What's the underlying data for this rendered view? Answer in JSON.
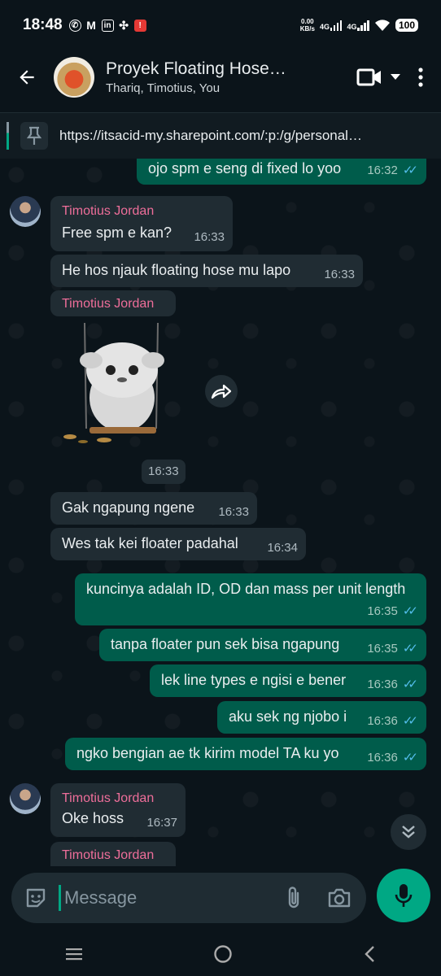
{
  "status_bar": {
    "time": "18:48",
    "net_speed_value": "0.00",
    "net_speed_unit": "KB/s",
    "sim1": "4G",
    "sim2": "4G",
    "battery": "100"
  },
  "header": {
    "title": "Proyek Floating Hose…",
    "subtitle": "Thariq, Timotius, You"
  },
  "pinned": {
    "url": "https://itsacid-my.sharepoint.com/:p:/g/personal…"
  },
  "messages": [
    {
      "dir": "out",
      "text": "ojo spm e seng di fixed lo yoo",
      "time": "16:32",
      "ticks": "✓✓"
    },
    {
      "dir": "in",
      "sender": "Timotius Jordan",
      "text": "Free spm e kan?",
      "time": "16:33"
    },
    {
      "dir": "in",
      "text": "He hos njauk floating hose mu lapo",
      "time": "16:33"
    },
    {
      "dir": "in",
      "sender": "Timotius Jordan",
      "sticker": true,
      "time": "16:33"
    },
    {
      "dir": "in",
      "text": "Gak ngapung ngene",
      "time": "16:33"
    },
    {
      "dir": "in",
      "text": "Wes tak kei floater padahal",
      "time": "16:34"
    },
    {
      "dir": "out",
      "text": "kuncinya adalah ID, OD dan mass per unit length",
      "time": "16:35",
      "ticks": "✓✓"
    },
    {
      "dir": "out",
      "text": "tanpa floater pun sek bisa ngapung",
      "time": "16:35",
      "ticks": "✓✓"
    },
    {
      "dir": "out",
      "text": "lek line types e ngisi e bener",
      "time": "16:36",
      "ticks": "✓✓"
    },
    {
      "dir": "out",
      "text": "aku sek ng njobo i",
      "time": "16:36",
      "ticks": "✓✓"
    },
    {
      "dir": "out",
      "text": "ngko bengian ae tk kirim model TA ku yo",
      "time": "16:36",
      "ticks": "✓✓"
    },
    {
      "dir": "in",
      "sender": "Timotius Jordan",
      "text": "Oke hoss",
      "time": "16:37"
    },
    {
      "dir": "in",
      "sender": "Timotius Jordan"
    }
  ],
  "composer": {
    "placeholder": "Message"
  },
  "colors": {
    "accent": "#00a884",
    "sender_name": "#ee6e9a",
    "outgoing_bubble": "#005c4b",
    "incoming_bubble": "#202c33",
    "read_ticks": "#53bdeb"
  }
}
